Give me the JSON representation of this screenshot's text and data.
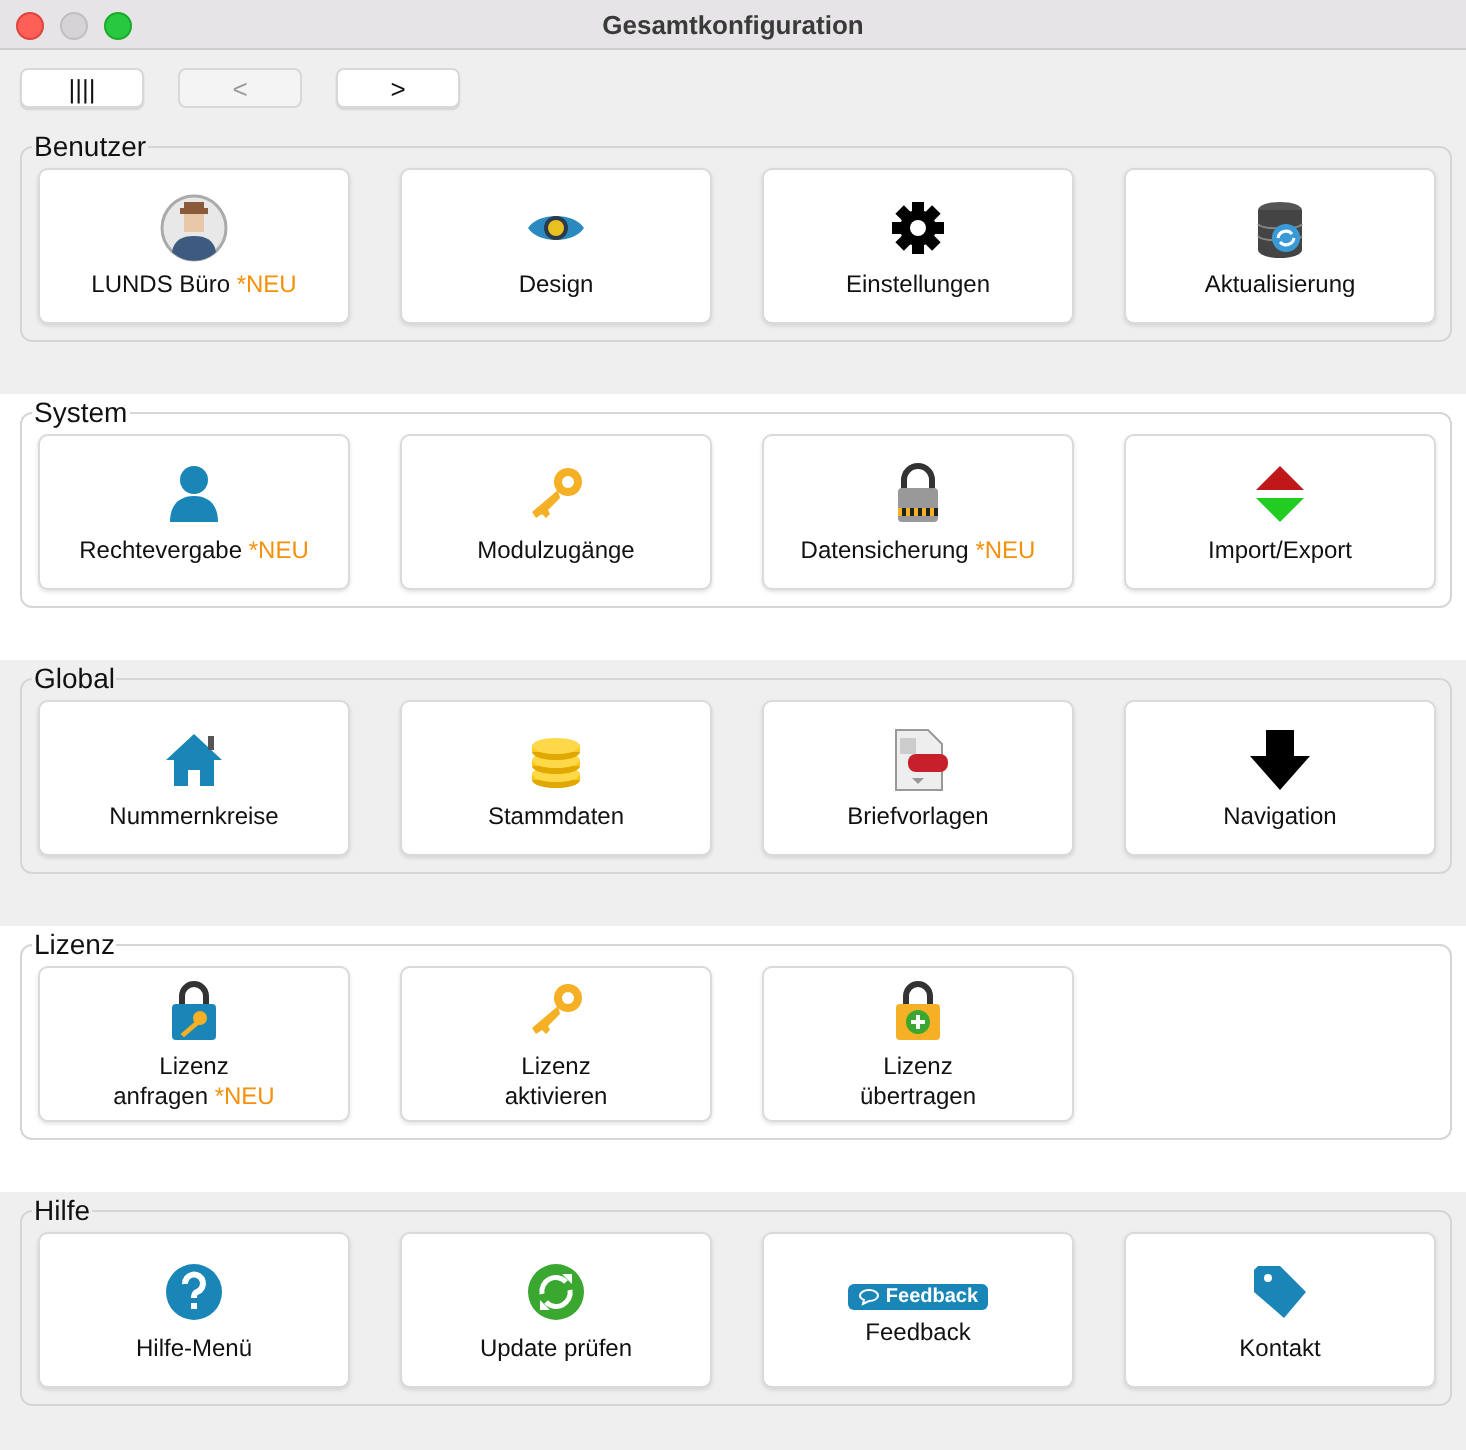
{
  "window": {
    "title": "Gesamtkonfiguration"
  },
  "toolbar": [
    {
      "label": "||||",
      "disabled": false
    },
    {
      "label": "<",
      "disabled": true
    },
    {
      "label": ">",
      "disabled": false
    }
  ],
  "sections": [
    {
      "title": "Benutzer",
      "tiles": [
        {
          "kind": "avatar",
          "lines": [
            "LUNDS Büro"
          ],
          "badge_new": "*NEU"
        },
        {
          "kind": "eye",
          "lines": [
            "Design"
          ]
        },
        {
          "kind": "gear",
          "lines": [
            "Einstellungen"
          ]
        },
        {
          "kind": "dbsync",
          "lines": [
            "Aktualisierung"
          ]
        }
      ]
    },
    {
      "title": "System",
      "tiles": [
        {
          "kind": "person",
          "lines": [
            "Rechtevergabe"
          ],
          "badge_new": "*NEU"
        },
        {
          "kind": "key",
          "lines": [
            "Modulzugänge"
          ]
        },
        {
          "kind": "padlock",
          "lines": [
            "Datensicherung"
          ],
          "badge_new": "*NEU"
        },
        {
          "kind": "updown",
          "lines": [
            "Import/Export"
          ]
        }
      ]
    },
    {
      "title": "Global",
      "tiles": [
        {
          "kind": "house",
          "lines": [
            "Nummernkreise"
          ]
        },
        {
          "kind": "coins",
          "lines": [
            "Stammdaten"
          ]
        },
        {
          "kind": "pdf",
          "lines": [
            "Briefvorlagen"
          ]
        },
        {
          "kind": "down",
          "lines": [
            "Navigation"
          ]
        }
      ]
    },
    {
      "title": "Lizenz",
      "tiles": [
        {
          "kind": "lockkey",
          "lines": [
            "Lizenz",
            "anfragen"
          ],
          "badge_new": "*NEU"
        },
        {
          "kind": "key",
          "lines": [
            "Lizenz",
            "aktivieren"
          ]
        },
        {
          "kind": "lockplus",
          "lines": [
            "Lizenz",
            "übertragen"
          ]
        }
      ]
    },
    {
      "title": "Hilfe",
      "tiles": [
        {
          "kind": "help",
          "lines": [
            "Hilfe-Menü"
          ]
        },
        {
          "kind": "refresh",
          "lines": [
            "Update prüfen"
          ]
        },
        {
          "kind": "feedback",
          "badge_text": "Feedback",
          "lines": [
            "Feedback"
          ]
        },
        {
          "kind": "tag",
          "lines": [
            "Kontakt"
          ]
        }
      ]
    }
  ]
}
